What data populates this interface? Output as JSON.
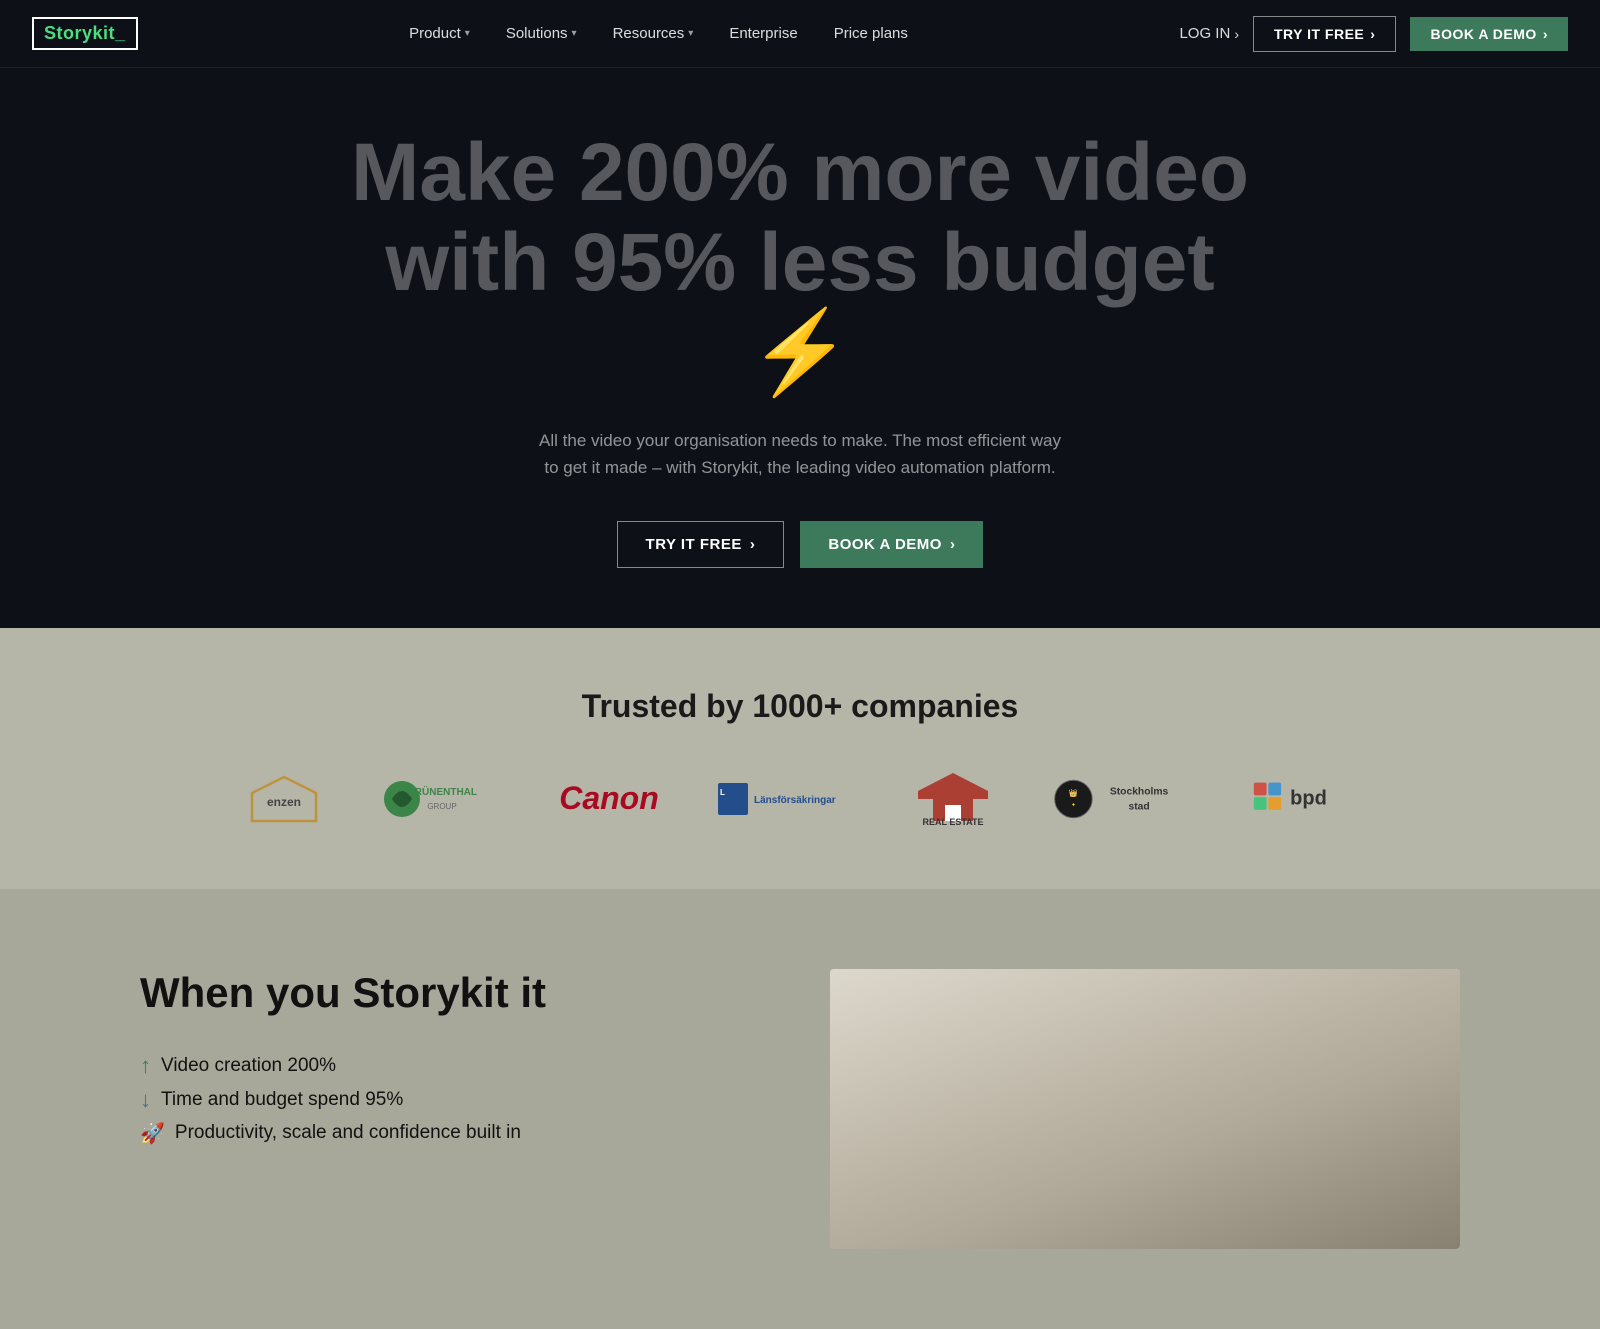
{
  "nav": {
    "logo_text": "Storykit_",
    "links": [
      {
        "label": "Product",
        "has_dropdown": true
      },
      {
        "label": "Solutions",
        "has_dropdown": true
      },
      {
        "label": "Resources",
        "has_dropdown": true
      },
      {
        "label": "Enterprise",
        "has_dropdown": false
      },
      {
        "label": "Price plans",
        "has_dropdown": false
      }
    ],
    "login_label": "LOG IN",
    "try_free_label": "TRY IT FREE",
    "book_demo_label": "BOOK A DEMO"
  },
  "hero": {
    "headline_line1": "Make 200% more video",
    "headline_line2": "with 95% less budget",
    "lightning_icon": "⚡",
    "subtext": "All the video your organisation needs to make. The most efficient way to get it made – with Storykit, the leading video automation platform.",
    "try_free_label": "TRY IT FREE",
    "book_demo_label": "BOOK A DEMO"
  },
  "trusted": {
    "title": "Trusted by 1000+ companies",
    "logos": [
      {
        "name": "enzen",
        "alt": "Enzen"
      },
      {
        "name": "grunenthal",
        "alt": "Grünenthal"
      },
      {
        "name": "canon",
        "alt": "Canon"
      },
      {
        "name": "lansforsakringar",
        "alt": "Länsförsäkringar"
      },
      {
        "name": "era",
        "alt": "ERA Real Estate"
      },
      {
        "name": "stockholm",
        "alt": "Stockholms Stad"
      },
      {
        "name": "bpd",
        "alt": "BPD"
      }
    ]
  },
  "storykit_section": {
    "title": "When you Storykit it",
    "stats": [
      {
        "label": "Video creation 200%",
        "icon": "up"
      },
      {
        "label": "Time and budget spend 95%",
        "icon": "down"
      },
      {
        "label": "Productivity, scale and confidence built in",
        "icon": "rocket"
      }
    ]
  }
}
